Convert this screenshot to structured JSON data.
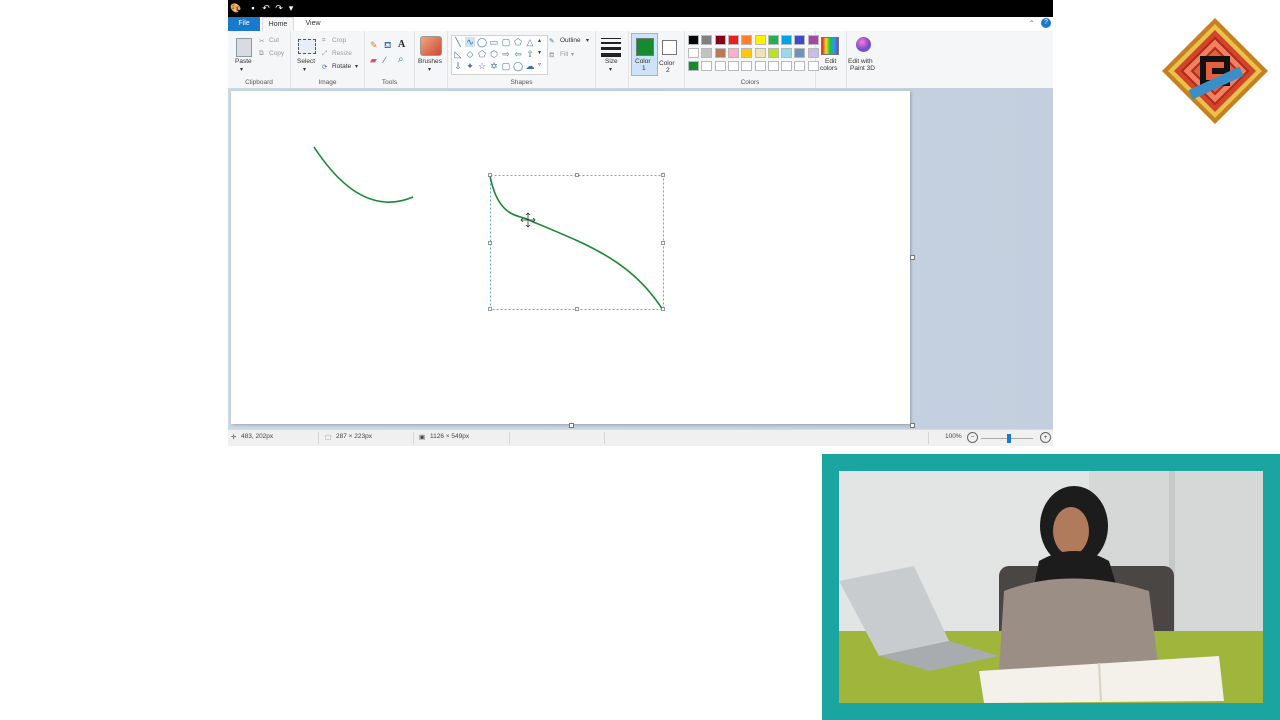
{
  "menu": {
    "file": "File",
    "home": "Home",
    "view": "View"
  },
  "ribbon": {
    "clipboard": {
      "label": "Clipboard",
      "paste": "Paste",
      "cut": "Cut",
      "copy": "Copy"
    },
    "image": {
      "label": "Image",
      "select": "Select",
      "crop": "Crop",
      "resize": "Resize",
      "rotate": "Rotate"
    },
    "tools": {
      "label": "Tools"
    },
    "brushes": {
      "label": "Brushes"
    },
    "shapes": {
      "label": "Shapes",
      "outline": "Outline",
      "fill": "Fill"
    },
    "size": {
      "label": "Size"
    },
    "color1": {
      "label_line1": "Color",
      "label_line2": "1"
    },
    "color2": {
      "label_line1": "Color",
      "label_line2": "2"
    },
    "colors": {
      "label": "Colors",
      "row1": [
        "#000000",
        "#7f7f7f",
        "#880015",
        "#ed1c24",
        "#ff7f27",
        "#fff200",
        "#22b14c",
        "#00a2e8",
        "#3f48cc",
        "#a349a4"
      ],
      "row2": [
        "#ffffff",
        "#c3c3c3",
        "#b97a57",
        "#ffaec9",
        "#ffc90e",
        "#efe4b0",
        "#b5e61d",
        "#99d9ea",
        "#7092be",
        "#c8bfe7"
      ],
      "row3": [
        "#168a2e",
        "#ffffff",
        "#ffffff",
        "#ffffff",
        "#ffffff",
        "#ffffff",
        "#ffffff",
        "#ffffff",
        "#ffffff",
        "#ffffff"
      ]
    },
    "edit_colors": {
      "line1": "Edit",
      "line2": "colors"
    },
    "paint3d": {
      "line1": "Edit with",
      "line2": "Paint 3D"
    }
  },
  "colors": {
    "accent": "#1979ca",
    "stroke": "#168a2e",
    "active_color1": "#168a2e",
    "teal_frame": "#1aa5a0"
  },
  "status": {
    "cursor_pos": "483, 202px",
    "selection_size": "287 × 223px",
    "image_size": "1126 × 549px",
    "zoom": "100%"
  },
  "zoom_level": 100
}
